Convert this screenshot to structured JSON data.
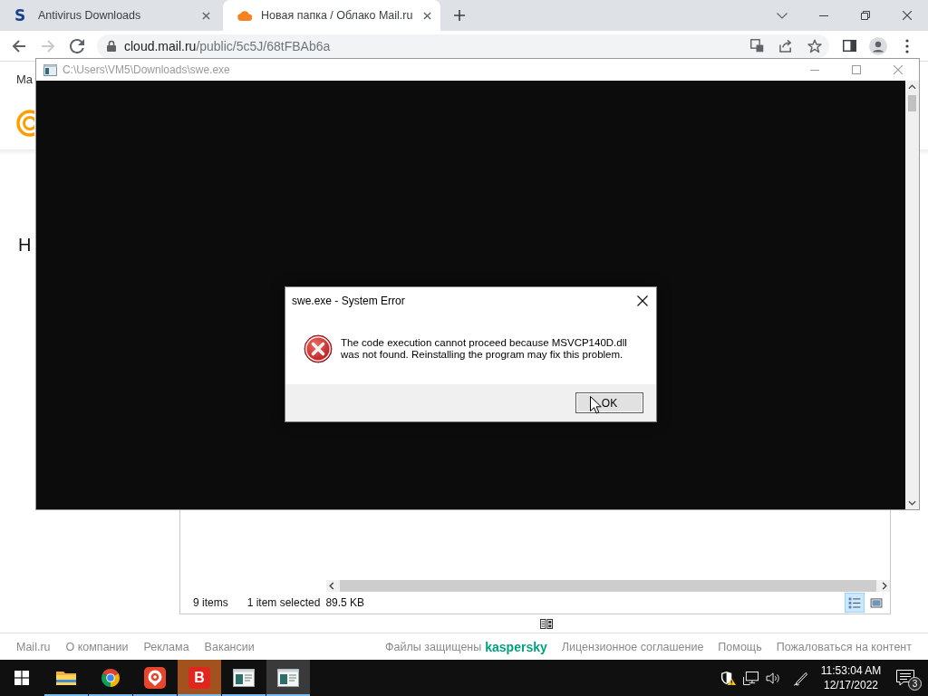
{
  "browser": {
    "tabs": [
      {
        "title": "Antivirus Downloads",
        "favicon": {
          "kind": "letter",
          "text": "S"
        },
        "selected": false
      },
      {
        "title": "Новая папка / Облако Mail.ru",
        "favicon": {
          "kind": "cloud"
        },
        "selected": true
      }
    ],
    "forward_disabled": true,
    "address": {
      "host": "cloud.mail.ru",
      "path": "/public/5c5J/68tFBAb6a"
    }
  },
  "page": {
    "header_text": "Ma",
    "heading": "Н",
    "file_panel": {
      "item_count": "9 items",
      "selection": "1 item selected",
      "selection_size": "89.5 KB",
      "views": [
        {
          "kind": "details",
          "selected": true
        },
        {
          "kind": "thumbnails",
          "selected": false
        }
      ]
    },
    "footer": {
      "links_left": [
        "Mail.ru",
        "О компании",
        "Реклама",
        "Вакансии"
      ],
      "protection_label": "Файлы защищены",
      "protection_brand": "kaspersky",
      "links_right": [
        "Лицензионное соглашение",
        "Помощь",
        "Пожаловаться на контент"
      ]
    }
  },
  "console_window": {
    "title": "C:\\Users\\VM5\\Downloads\\swe.exe",
    "active": false
  },
  "dialog": {
    "title": "swe.exe - System Error",
    "message": "The code execution cannot proceed because MSVCP140D.dll was not found. Reinstalling the program may fix this problem.",
    "button": "OK"
  },
  "taskbar": {
    "apps": [
      {
        "kind": "folder",
        "running": true,
        "selected": false,
        "flashing": false
      },
      {
        "kind": "browser",
        "running": true,
        "selected": false,
        "flashing": false
      },
      {
        "kind": "pin",
        "running": true,
        "selected": false,
        "flashing": false
      },
      {
        "kind": "letter",
        "label": "B",
        "running": true,
        "selected": false,
        "flashing": true
      },
      {
        "kind": "window",
        "running": true,
        "selected": false,
        "flashing": false
      },
      {
        "kind": "window",
        "running": true,
        "selected": true,
        "flashing": false
      }
    ],
    "clock": {
      "time": "11:53:04 AM",
      "date": "12/17/2022"
    },
    "notification_count": "3"
  }
}
